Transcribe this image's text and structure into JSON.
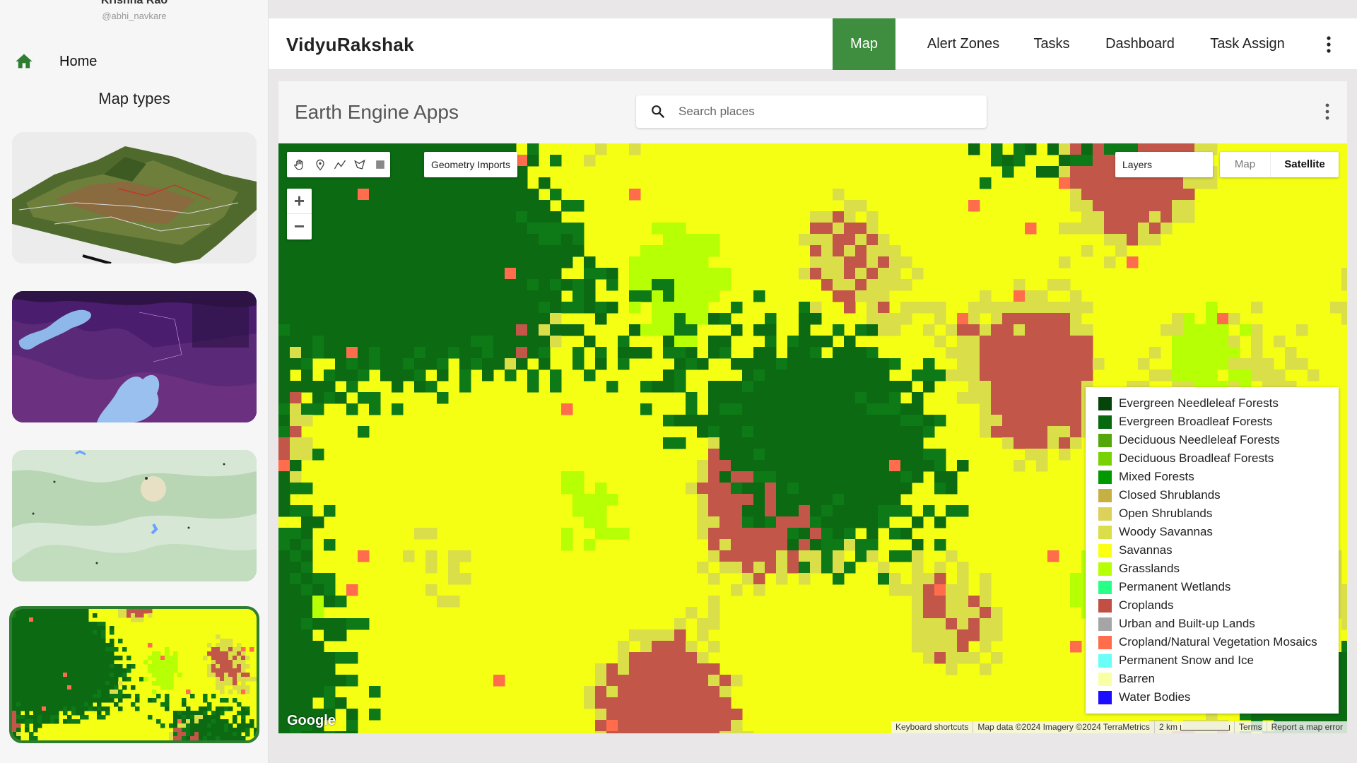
{
  "user": {
    "name": "Krishna Rao",
    "handle": "@abhi_navkare"
  },
  "sidebar": {
    "home_label": "Home",
    "map_types_title": "Map types",
    "thumbnails": [
      "terrain-3d",
      "night-lights",
      "street-map",
      "land-cover"
    ],
    "selected_thumbnail": "land-cover"
  },
  "header": {
    "app_title": "VidyuRakshak",
    "nav": [
      "Map",
      "Alert Zones",
      "Tasks",
      "Dashboard",
      "Task Assign"
    ],
    "active_nav": "Map",
    "accent_color": "#3f8e3f"
  },
  "ee": {
    "title": "Earth Engine Apps",
    "search_placeholder": "Search places",
    "geometry_imports": "Geometry Imports",
    "layers": "Layers",
    "map_type_options": [
      "Map",
      "Satellite"
    ],
    "map_type_selected": "Satellite",
    "zoom_in": "+",
    "zoom_out": "−",
    "google_logo": "Google",
    "attribution": [
      "Keyboard shortcuts",
      "Map data ©2024 Imagery ©2024 TerraMetrics",
      "2 km",
      "Terms",
      "Report a map error"
    ]
  },
  "legend": [
    {
      "label": "Evergreen Needleleaf Forests",
      "color": "#05450a"
    },
    {
      "label": "Evergreen Broadleaf Forests",
      "color": "#086a10"
    },
    {
      "label": "Deciduous Needleleaf Forests",
      "color": "#54a708"
    },
    {
      "label": "Deciduous Broadleaf Forests",
      "color": "#78d203"
    },
    {
      "label": "Mixed Forests",
      "color": "#009900"
    },
    {
      "label": "Closed Shrublands",
      "color": "#c6b044"
    },
    {
      "label": "Open Shrublands",
      "color": "#dcd159"
    },
    {
      "label": "Woody Savannas",
      "color": "#dade48"
    },
    {
      "label": "Savannas",
      "color": "#fbff13"
    },
    {
      "label": "Grasslands",
      "color": "#b6ff05"
    },
    {
      "label": "Permanent Wetlands",
      "color": "#27ff87"
    },
    {
      "label": "Croplands",
      "color": "#c24f44"
    },
    {
      "label": "Urban and Built-up Lands",
      "color": "#a5a5a5"
    },
    {
      "label": "Cropland/Natural Vegetation Mosaics",
      "color": "#ff6d4c"
    },
    {
      "label": "Permanent Snow and Ice",
      "color": "#69fff8"
    },
    {
      "label": "Barren",
      "color": "#f9ffa4"
    },
    {
      "label": "Water Bodies",
      "color": "#1c0dff"
    }
  ]
}
